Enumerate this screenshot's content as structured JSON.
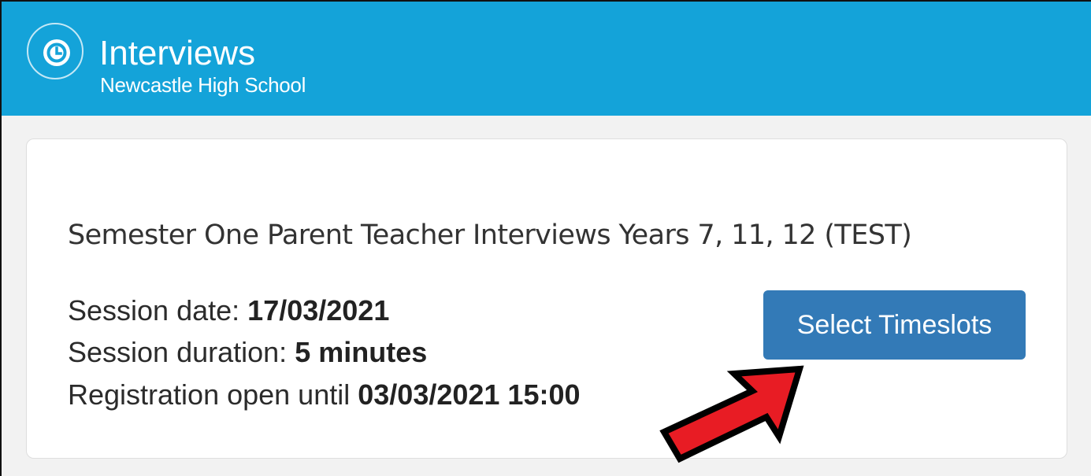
{
  "header": {
    "app_title": "Interviews",
    "school_name": "Newcastle High School",
    "logo_icon": "clock-icon",
    "background_color": "#14a3d9"
  },
  "session": {
    "title": "Semester One Parent Teacher Interviews Years 7, 11, 12 (TEST)",
    "date_label": "Session date:",
    "date_value": "17/03/2021",
    "duration_label": "Session duration:",
    "duration_value": "5 minutes",
    "registration_label": "Registration open until",
    "registration_value": "03/03/2021 15:00",
    "select_button_label": "Select Timeslots",
    "button_color": "#337ab7"
  },
  "annotation": {
    "arrow_icon": "red-arrow-icon",
    "arrow_color": "#e81c24"
  }
}
